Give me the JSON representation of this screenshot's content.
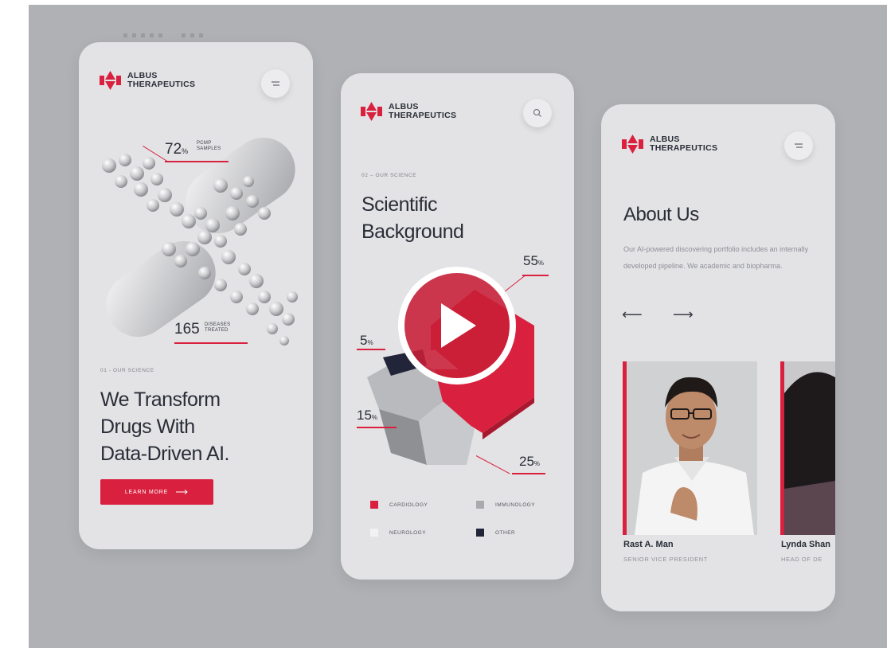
{
  "colors": {
    "accent": "#d9213f",
    "background": "#b0b1b4",
    "card": "#e3e3e5",
    "dark": "#2a2d38"
  },
  "brand": {
    "line1": "ALBUS",
    "line2": "THERAPEUTICS"
  },
  "screen1": {
    "stat1": {
      "value": "72",
      "unit": "%",
      "label_line1": "PCMP",
      "label_line2": "SAMPLES"
    },
    "stat2": {
      "value": "165",
      "label_line1": "DISEASES",
      "label_line2": "TREATED"
    },
    "eyebrow": "01 - OUR SCIENCE",
    "title_lines": [
      "We Transform",
      "Drugs With",
      "Data-Driven AI."
    ],
    "cta_label": "LEARN MORE",
    "menu_icon": "menu-icon"
  },
  "screen2": {
    "eyebrow": "02 – OUR SCIENCE",
    "title_lines": [
      "Scientific",
      "Background"
    ],
    "pct_55": "55",
    "pct_5": "5",
    "pct_15": "15",
    "pct_25": "25",
    "pct_unit": "%",
    "legend": [
      {
        "label": "CARDIOLOGY",
        "color": "#d9213f"
      },
      {
        "label": "IMMUNOLOGY",
        "color": "#a9aaae"
      },
      {
        "label": "NEUROLOGY",
        "color": "#f2f2f3"
      },
      {
        "label": "OTHER",
        "color": "#22243a"
      }
    ],
    "search_icon": "search-icon"
  },
  "screen3": {
    "title": "About Us",
    "text": "Our AI-powered discovering portfolio includes an internally developed pipeline. We academic and biopharma.",
    "prev_arrow": "⟵",
    "next_arrow": "⟶",
    "members": [
      {
        "name": "Rast A. Man",
        "role": "SENIOR VICE PRESIDENT"
      },
      {
        "name": "Lynda Shan",
        "role": "HEAD OF DE"
      }
    ],
    "menu_icon": "menu-icon"
  },
  "video": {
    "play_icon": "play-icon"
  }
}
